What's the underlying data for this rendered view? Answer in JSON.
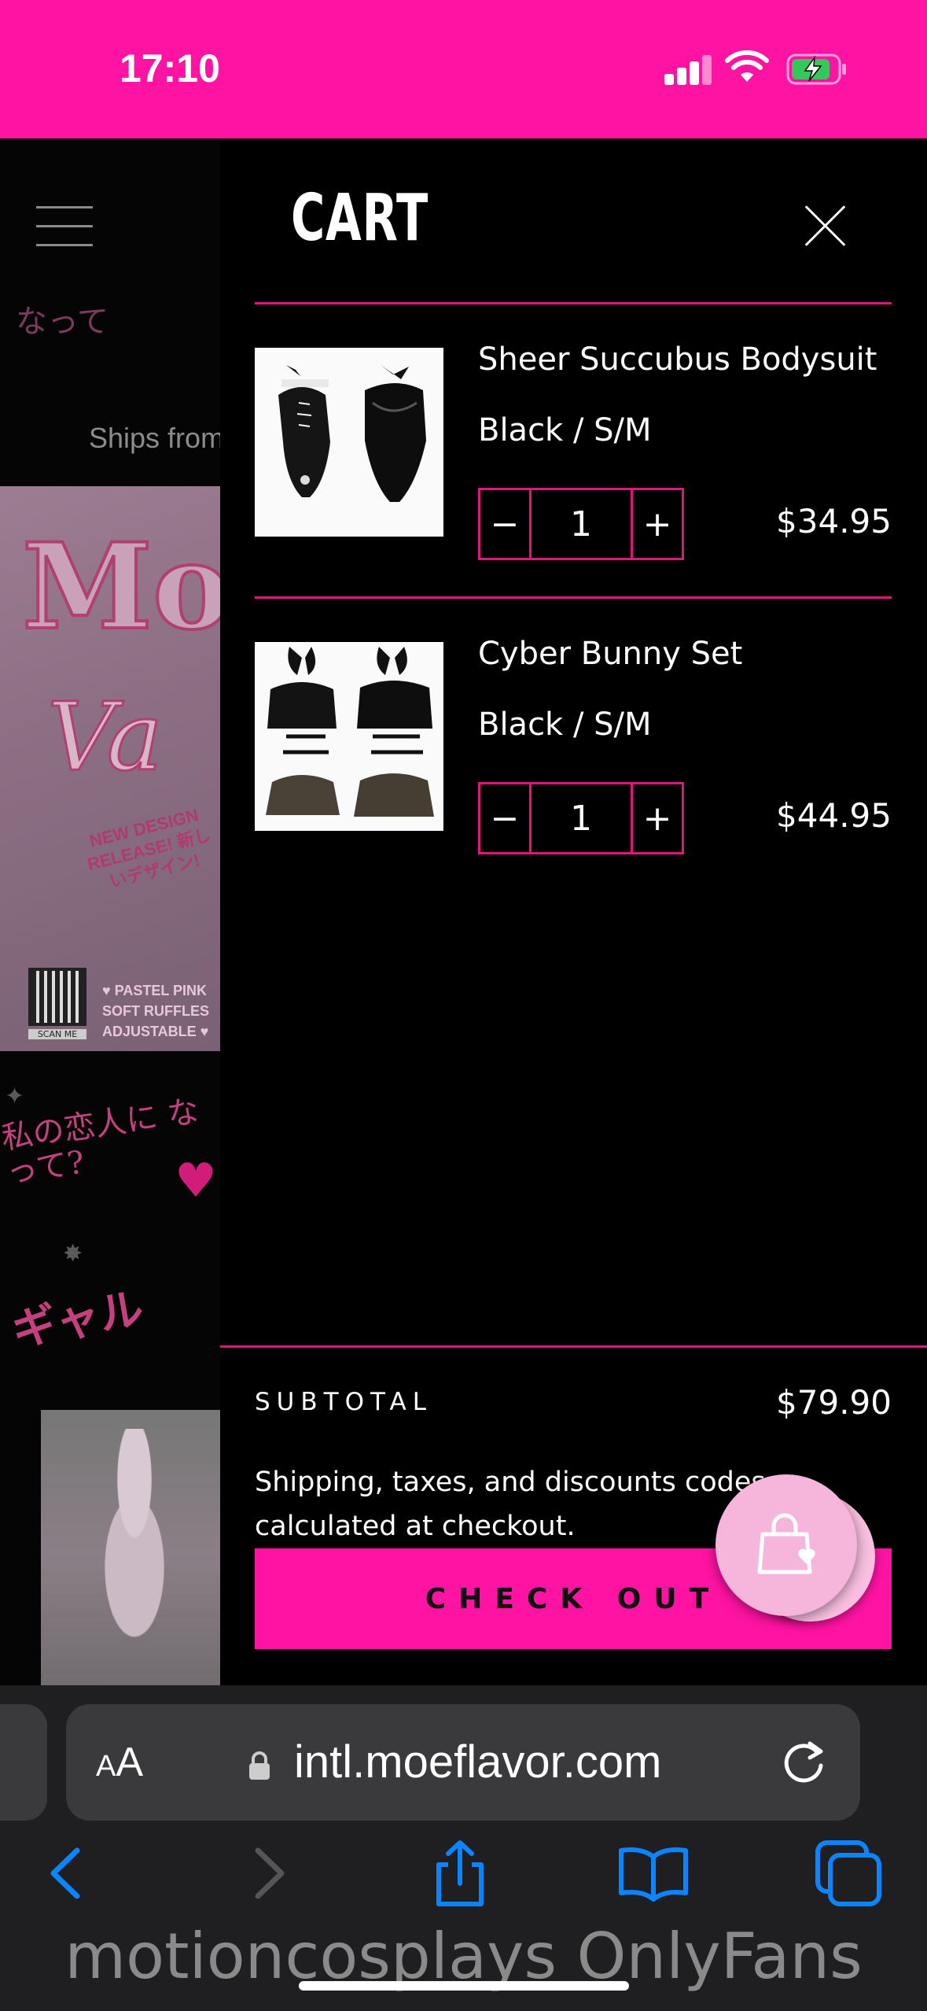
{
  "status_bar": {
    "time": "17:10",
    "background": "#ff13a3"
  },
  "background_page": {
    "menu_icon": "hamburger-icon",
    "ships_text": "Ships from",
    "banner": {
      "title_partial_1": "Mo",
      "title_partial_2": "Va",
      "release_text": "NEW DESIGN RELEASE! 新しいデザイン!",
      "qr_label": "SCAN ME",
      "features": [
        "♥ PASTEL PINK",
        "SOFT RUFFLES",
        "ADJUSTABLE ♥"
      ]
    },
    "jp_text": "私の恋人に なって?",
    "gyaru_text": "ギャル"
  },
  "cart": {
    "title": "CART",
    "accent_color": "#e0157e",
    "items": [
      {
        "name": "Sheer Succubus Bodysuit",
        "variant": "Black / S/M",
        "quantity": "1",
        "price": "$34.95",
        "decrease_label": "−",
        "increase_label": "+"
      },
      {
        "name": "Cyber Bunny Set",
        "variant": "Black / S/M",
        "quantity": "1",
        "price": "$44.95",
        "decrease_label": "−",
        "increase_label": "+"
      }
    ],
    "subtotal_label": "SUBTOTAL",
    "subtotal_value": "$79.90",
    "shipping_note": "Shipping, taxes, and discounts codes calculated at checkout.",
    "checkout_label": "CHECK OUT"
  },
  "browser": {
    "aa_label_big": "A",
    "aa_label_small": "A",
    "url": "intl.moeflavor.com",
    "toolbar_icons": [
      "back-icon",
      "forward-icon",
      "share-icon",
      "bookmarks-icon",
      "tabs-icon"
    ]
  },
  "watermark": "motioncosplays OnlyFans"
}
